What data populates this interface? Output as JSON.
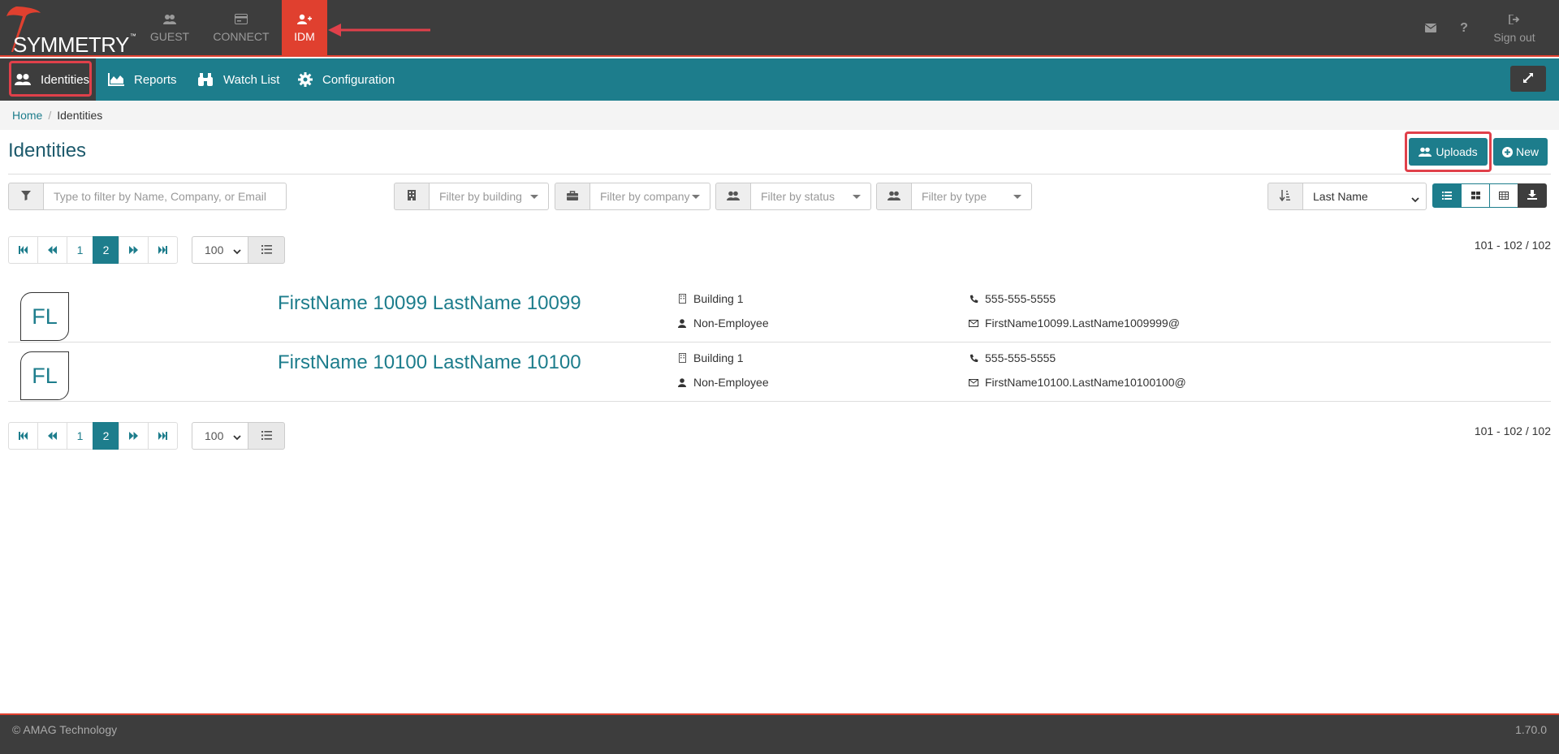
{
  "brand": {
    "logo_text": "SYMMETRY",
    "trademark": "™"
  },
  "app_tabs": [
    {
      "label": "GUEST",
      "icon": "users-icon"
    },
    {
      "label": "CONNECT",
      "icon": "card-icon"
    },
    {
      "label": "IDM",
      "icon": "user-plus-icon",
      "active": true
    }
  ],
  "top_right": {
    "signout_label": "Sign out"
  },
  "nav": {
    "items": [
      {
        "label": "Identities",
        "icon": "users-icon",
        "active": true
      },
      {
        "label": "Reports",
        "icon": "area-chart-icon"
      },
      {
        "label": "Watch List",
        "icon": "binoculars-icon"
      },
      {
        "label": "Configuration",
        "icon": "gear-icon"
      }
    ]
  },
  "breadcrumb": {
    "home": "Home",
    "separator": "/",
    "current": "Identities"
  },
  "page": {
    "title": "Identities",
    "uploads_label": "Uploads",
    "new_label": "New"
  },
  "filters": {
    "search_placeholder": "Type to filter by Name, Company, or Email",
    "building_placeholder": "Filter by building",
    "company_placeholder": "Filter by company",
    "status_placeholder": "Filter by status",
    "type_placeholder": "Filter by type",
    "sort_value": "Last Name"
  },
  "pagination": {
    "pages": [
      "1",
      "2"
    ],
    "current_page": "2",
    "page_size": "100",
    "count_text": "101 - 102 / 102"
  },
  "identities": [
    {
      "initials": "FL",
      "name": "FirstName 10099 LastName 10099",
      "building": "Building 1",
      "type": "Non-Employee",
      "phone": "555-555-5555",
      "email": "FirstName10099.LastName1009999@"
    },
    {
      "initials": "FL",
      "name": "FirstName 10100 LastName 10100",
      "building": "Building 1",
      "type": "Non-Employee",
      "phone": "555-555-5555",
      "email": "FirstName10100.LastName10100100@"
    }
  ],
  "footer": {
    "copyright": "© AMAG Technology",
    "version": "1.70.0"
  },
  "colors": {
    "accent": "#1d7d8c",
    "brand_red": "#e0402f",
    "dark": "#3d3d3d",
    "annotation": "#e0404a"
  }
}
